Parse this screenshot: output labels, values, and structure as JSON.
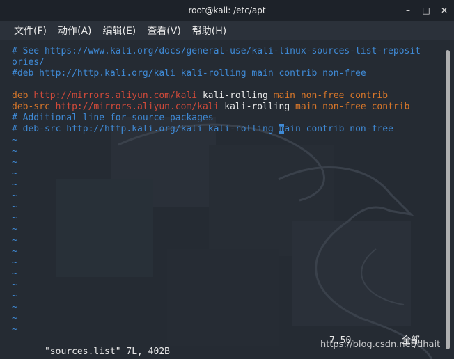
{
  "window": {
    "title": "root@kali: /etc/apt",
    "buttons": {
      "minimize": "–",
      "maximize": "□",
      "close": "✕"
    }
  },
  "menubar": {
    "items": [
      "文件(F)",
      "动作(A)",
      "编辑(E)",
      "查看(V)",
      "帮助(H)"
    ]
  },
  "editor": {
    "lines": [
      {
        "kind": "comment",
        "text": "# See https://www.kali.org/docs/general-use/kali-linux-sources-list-reposit"
      },
      {
        "kind": "comment",
        "text": "ories/"
      },
      {
        "kind": "comment",
        "text": "#deb http://http.kali.org/kali kali-rolling main contrib non-free"
      },
      {
        "kind": "blank",
        "text": ""
      },
      {
        "kind": "deb",
        "keyword": "deb",
        "url": "http://mirrors.aliyun.com/kali",
        "dist": "kali-rolling",
        "components": "main non-free contrib"
      },
      {
        "kind": "deb",
        "keyword": "deb-src",
        "url": "http://mirrors.aliyun.com/kali",
        "dist": "kali-rolling",
        "components": "main non-free contrib"
      },
      {
        "kind": "comment",
        "text": "# Additional line for source packages"
      },
      {
        "kind": "cursorline",
        "before": "# deb-src http://http.kali.org/kali kali-rolling ",
        "cursor": "m",
        "after": "ain contrib non-free"
      }
    ],
    "tilde": "~",
    "tilde_count": 18
  },
  "status": {
    "file": "\"sources.list\" 7L, 402B",
    "position": "7,50",
    "percent": "全部"
  },
  "watermark": "https://blog.csdn.net/dhait"
}
